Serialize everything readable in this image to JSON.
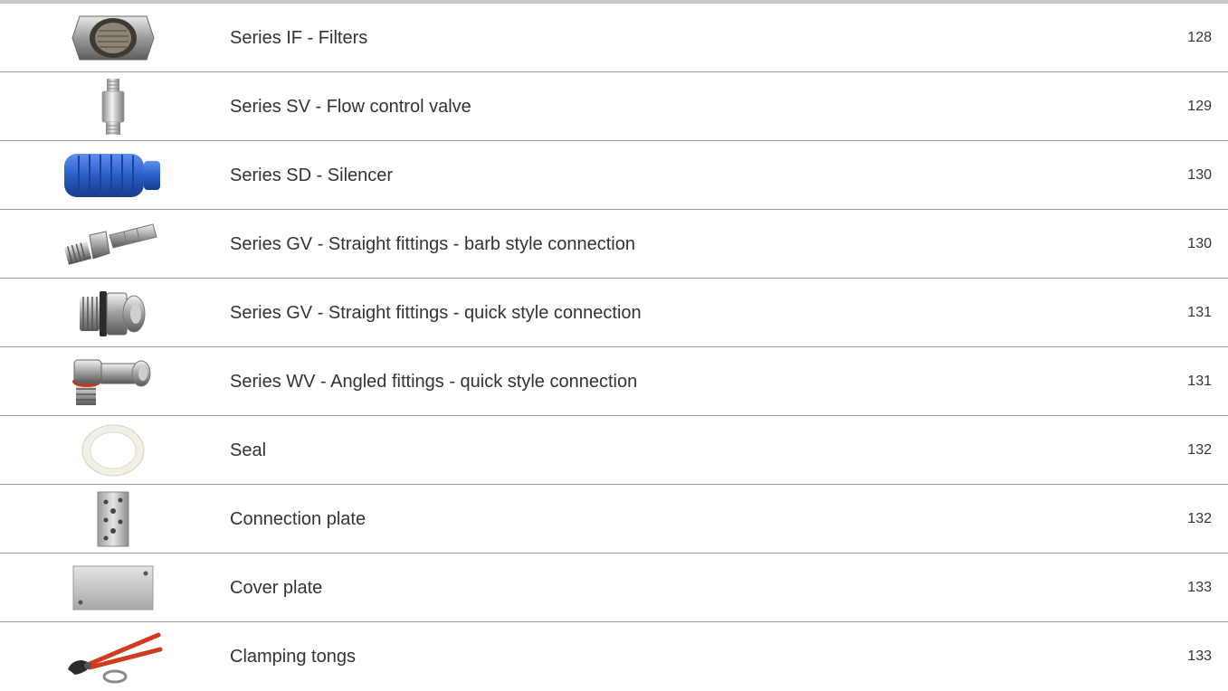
{
  "catalog": {
    "rows": [
      {
        "thumb": "filter-icon",
        "label": "Series IF - Filters",
        "page": "128"
      },
      {
        "thumb": "flow-control-valve-icon",
        "label": "Series SV - Flow control valve",
        "page": "129"
      },
      {
        "thumb": "silencer-icon",
        "label": "Series SD - Silencer",
        "page": "130"
      },
      {
        "thumb": "barb-fitting-icon",
        "label": "Series GV - Straight fittings - barb style connection",
        "page": "130"
      },
      {
        "thumb": "quick-fitting-icon",
        "label": "Series GV - Straight fittings - quick style connection",
        "page": "131"
      },
      {
        "thumb": "angled-fitting-icon",
        "label": "Series WV - Angled fittings - quick style connection",
        "page": "131"
      },
      {
        "thumb": "seal-icon",
        "label": "Seal",
        "page": "132"
      },
      {
        "thumb": "connection-plate-icon",
        "label": "Connection plate",
        "page": "132"
      },
      {
        "thumb": "cover-plate-icon",
        "label": "Cover plate",
        "page": "133"
      },
      {
        "thumb": "clamping-tongs-icon",
        "label": "Clamping tongs",
        "page": "133"
      }
    ]
  },
  "colors": {
    "rule": "#9a9a9a",
    "text": "#333333",
    "silencer_blue": "#2a5fc8",
    "tong_handle_red": "#d23a1e"
  }
}
